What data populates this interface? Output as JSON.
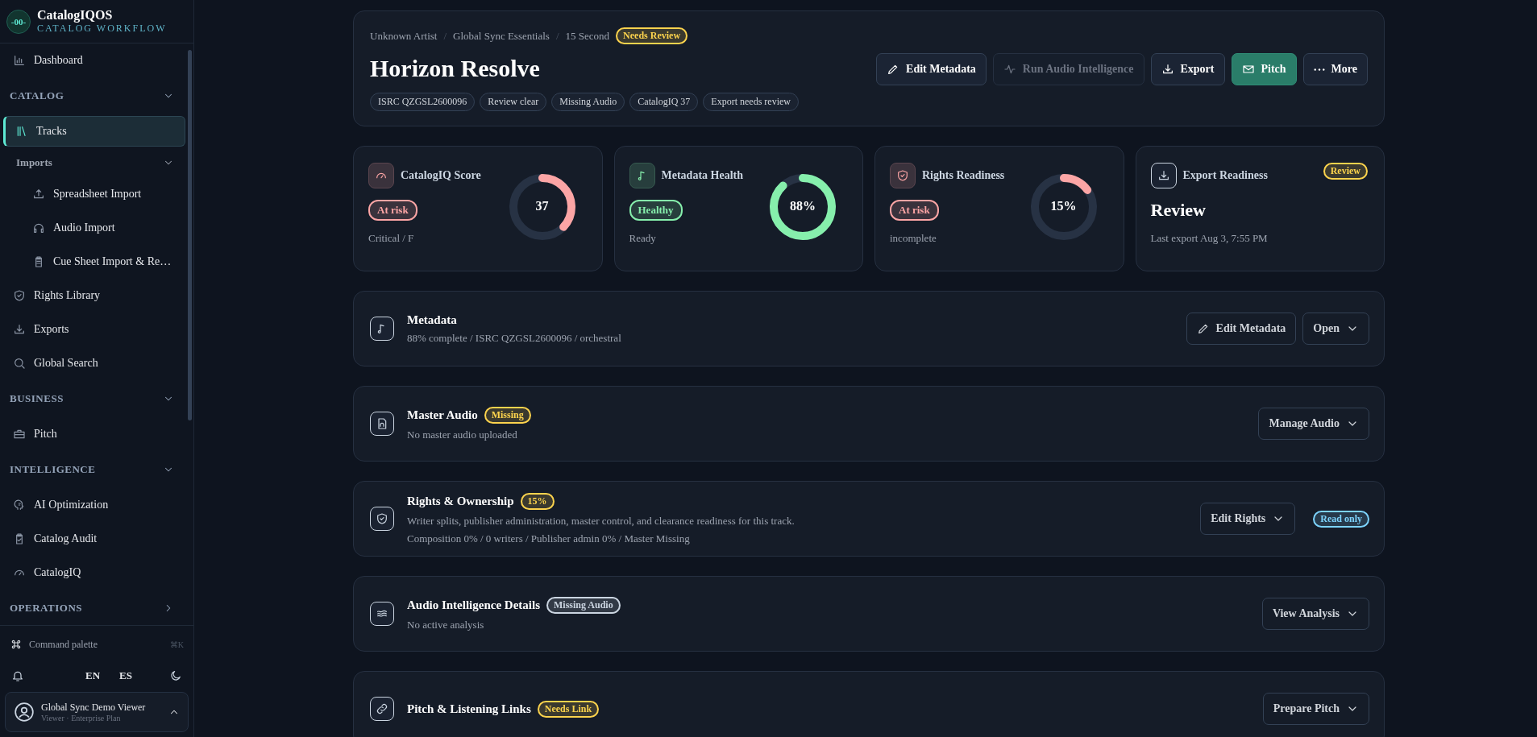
{
  "brand": {
    "logo_mark": "-00-",
    "name": "CatalogIQOS",
    "tagline": "CATALOG WORKFLOW"
  },
  "sidebar": {
    "items": [
      {
        "kind": "link",
        "label": "Dashboard",
        "selected": false
      },
      {
        "kind": "section",
        "label": "CATALOG",
        "expanded": true
      },
      {
        "kind": "link",
        "label": "Tracks",
        "selected": true
      },
      {
        "kind": "group",
        "label": "Imports",
        "expanded": true
      },
      {
        "kind": "sublink",
        "label": "Spreadsheet Import",
        "selected": false
      },
      {
        "kind": "sublink",
        "label": "Audio Import",
        "selected": false
      },
      {
        "kind": "sublink",
        "label": "Cue Sheet Import & Re…",
        "selected": false
      },
      {
        "kind": "link",
        "label": "Rights Library",
        "selected": false
      },
      {
        "kind": "link",
        "label": "Exports",
        "selected": false
      },
      {
        "kind": "link",
        "label": "Global Search",
        "selected": false
      },
      {
        "kind": "section",
        "label": "BUSINESS",
        "expanded": true
      },
      {
        "kind": "link",
        "label": "Pitch",
        "selected": false
      },
      {
        "kind": "section",
        "label": "INTELLIGENCE",
        "expanded": true
      },
      {
        "kind": "link",
        "label": "AI Optimization",
        "selected": false
      },
      {
        "kind": "link",
        "label": "Catalog Audit",
        "selected": false
      },
      {
        "kind": "link",
        "label": "CatalogIQ",
        "selected": false
      },
      {
        "kind": "section",
        "label": "OPERATIONS",
        "expanded": false
      }
    ],
    "command_palette": {
      "label": "Command palette",
      "shortcut": "⌘K"
    },
    "languages": [
      "EN",
      "ES"
    ],
    "user": {
      "name": "Global Sync Demo Viewer",
      "role": "Viewer · Enterprise Plan"
    }
  },
  "header": {
    "breadcrumbs": [
      "Unknown Artist",
      "Global Sync Essentials",
      "15 Second"
    ],
    "separator": "/",
    "status": {
      "label": "Needs Review",
      "color": "#fcd34d"
    },
    "title": "Horizon Resolve",
    "chips": [
      "ISRC QZGSL2600096",
      "Review clear",
      "Missing Audio",
      "CatalogIQ 37",
      "Export needs review"
    ],
    "actions": [
      {
        "kind": "edit",
        "label": "Edit Metadata",
        "disabled": false
      },
      {
        "kind": "analyze",
        "label": "Run Audio Intelligence",
        "disabled": true
      },
      {
        "kind": "export",
        "label": "Export",
        "disabled": false
      },
      {
        "kind": "pitch",
        "label": "Pitch",
        "disabled": false
      },
      {
        "kind": "more",
        "label": "More",
        "disabled": false
      }
    ]
  },
  "score_cards": [
    {
      "kind": "donut",
      "title": "CatalogIQ Score",
      "color": "#fca5a5",
      "badge": "At risk",
      "caption": "Critical / F",
      "value": "37",
      "level": 0.37
    },
    {
      "kind": "donut",
      "title": "Metadata Health",
      "color": "#86efac",
      "badge": "Healthy",
      "caption": "Ready",
      "value": "88%",
      "level": 0.88
    },
    {
      "kind": "donut",
      "title": "Rights Readiness",
      "color": "#fca5a5",
      "badge": "At risk",
      "caption": "incomplete",
      "value": "15%",
      "level": 0.15
    },
    {
      "kind": "status",
      "title": "Export Readiness",
      "color": "#fcd34d",
      "badge": "Review",
      "headline": "Review",
      "caption": "Last export Aug 3, 7:55 PM"
    }
  ],
  "sections": [
    {
      "title": "Metadata",
      "lines": [
        "88% complete / ISRC QZGSL2600096 / orchestral"
      ],
      "actions": [
        {
          "kind": "edit",
          "label": "Edit Metadata"
        },
        {
          "kind": "menu",
          "label": "Open"
        }
      ]
    },
    {
      "title": "Master Audio",
      "badge": {
        "label": "Missing",
        "color": "#fcd34d"
      },
      "lines": [
        "No master audio uploaded"
      ],
      "actions": [
        {
          "kind": "menu",
          "label": "Manage Audio"
        }
      ]
    },
    {
      "title": "Rights & Ownership",
      "badge": {
        "label": "15%",
        "color": "#fcd34d"
      },
      "lines": [
        "Writer splits, publisher administration, master control, and clearance readiness for this track.",
        "Composition 0% / 0 writers / Publisher admin 0% / Master Missing"
      ],
      "actions": [
        {
          "kind": "menu",
          "label": "Edit Rights"
        }
      ],
      "tag": {
        "label": "Read only",
        "color": "#7dd3fc"
      }
    },
    {
      "title": "Audio Intelligence Details",
      "badge": {
        "label": "Missing Audio",
        "color": "#cbd5e1"
      },
      "lines": [
        "No active analysis"
      ],
      "actions": [
        {
          "kind": "menu",
          "label": "View Analysis"
        }
      ]
    },
    {
      "title": "Pitch & Listening Links",
      "badge": {
        "label": "Needs Link",
        "color": "#fcd34d"
      },
      "actions": [
        {
          "kind": "menu",
          "label": "Prepare Pitch"
        }
      ]
    }
  ]
}
